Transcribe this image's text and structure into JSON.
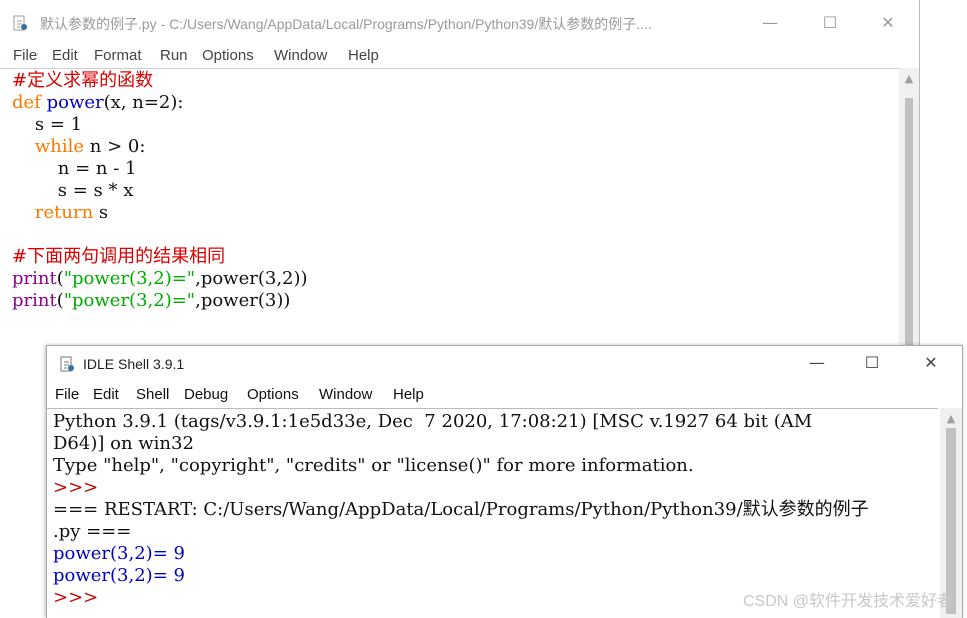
{
  "editor": {
    "title": "默认参数的例子.py - C:/Users/Wang/AppData/Local/Programs/Python/Python39/默认参数的例子....",
    "window_buttons": {
      "minimize": "—",
      "maximize": "☐",
      "close": "✕"
    },
    "menu": [
      "File",
      "Edit",
      "Format",
      "Run",
      "Options",
      "Window",
      "Help"
    ],
    "code": [
      {
        "comment": "#定义求幂的函数"
      },
      {
        "kw": "def",
        "builtin": "power",
        "rest": "(x, n=2):"
      },
      {
        "text": "    s = 1"
      },
      {
        "indent": "    ",
        "kw": "while",
        "rest": " n > 0:"
      },
      {
        "text": "        n = n - 1"
      },
      {
        "text": "        s = s * x"
      },
      {
        "indent": "    ",
        "kw": "return",
        "rest": " s"
      },
      {
        "text": ""
      },
      {
        "comment": "#下面两句调用的结果相同"
      },
      {
        "builtin": "print",
        "open": "(",
        "string": "\"power(3,2)=\"",
        "rest": ",power(3,2))"
      },
      {
        "builtin": "print",
        "open": "(",
        "string": "\"power(3,2)=\"",
        "rest": ",power(3))"
      }
    ]
  },
  "shell": {
    "title": "IDLE Shell 3.9.1",
    "window_buttons": {
      "minimize": "—",
      "maximize": "☐",
      "close": "✕"
    },
    "menu": [
      "File",
      "Edit",
      "Shell",
      "Debug",
      "Options",
      "Window",
      "Help"
    ],
    "lines": [
      "Python 3.9.1 (tags/v3.9.1:1e5d33e, Dec  7 2020, 17:08:21) [MSC v.1927 64 bit (AM",
      "D64)] on win32",
      "Type \"help\", \"copyright\", \"credits\" or \"license()\" for more information.",
      ">>> ",
      "=== RESTART: C:/Users/Wang/AppData/Local/Programs/Python/Python39/默认参数的例子",
      ".py ===",
      "power(3,2)= 9",
      "power(3,2)= 9",
      ">>> "
    ]
  },
  "watermark": "CSDN @软件开发技术爱好者"
}
